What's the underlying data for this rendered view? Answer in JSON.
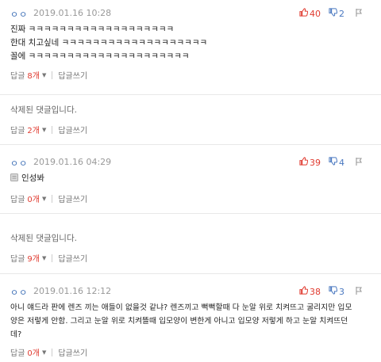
{
  "comments": [
    {
      "user": "ㅇㅇ",
      "date": "2019.01.16 10:28",
      "up": "40",
      "down": "2",
      "lines": [
        "진짜 ㅋㅋㅋㅋㅋㅋㅋㅋㅋㅋㅋㅋㅋㅋㅋㅋㅋㅋㅋ",
        "한대 치고싶네 ㅋㅋㅋㅋㅋㅋㅋㅋㅋㅋㅋㅋㅋㅋㅋㅋㅋㅋㅋ",
        "꼴에 ㅋㅋㅋㅋㅋㅋㅋㅋㅋㅋㅋㅋㅋㅋㅋㅋㅋㅋㅋㅋㅋ"
      ],
      "reply_label": "답글",
      "reply_count": "8개",
      "write_label": "답글쓰기"
    },
    {
      "deleted_text": "삭제된 댓글입니다.",
      "reply_label": "답글",
      "reply_count": "2개",
      "write_label": "답글쓰기"
    },
    {
      "user": "ㅇㅇ",
      "date": "2019.01.16 04:29",
      "up": "39",
      "down": "4",
      "lines": [
        "인성봐"
      ],
      "reply_label": "답글",
      "reply_count": "0개",
      "write_label": "답글쓰기"
    },
    {
      "deleted_text": "삭제된 댓글입니다.",
      "reply_label": "답글",
      "reply_count": "9개",
      "write_label": "답글쓰기"
    },
    {
      "user": "ㅇㅇ",
      "date": "2019.01.16 12:12",
      "up": "38",
      "down": "3",
      "lines": [
        "아니 얘드라 판에 렌즈 끼는 애들이 없을것 같냐? 렌즈끼고 뻑뻑할때 다 눈알 위로 치켜뜨고 굴리지만 입모",
        "양은 저렇게 안함. 그리고 눈알 위로 치켜뜰때 입모양이 변한게 아니고 입모양 저렇게 하고 눈알 치켜뜨던",
        "데?"
      ],
      "reply_label": "답글",
      "reply_count": "0개",
      "write_label": "답글쓰기"
    }
  ],
  "colors": {
    "up": "#e03a2f",
    "down": "#4a78c0",
    "meta": "#999999",
    "divider": "#e8e8e8"
  },
  "icons": {
    "up": "thumbs-up-icon",
    "down": "thumbs-down-icon",
    "report": "report-flag-icon"
  }
}
